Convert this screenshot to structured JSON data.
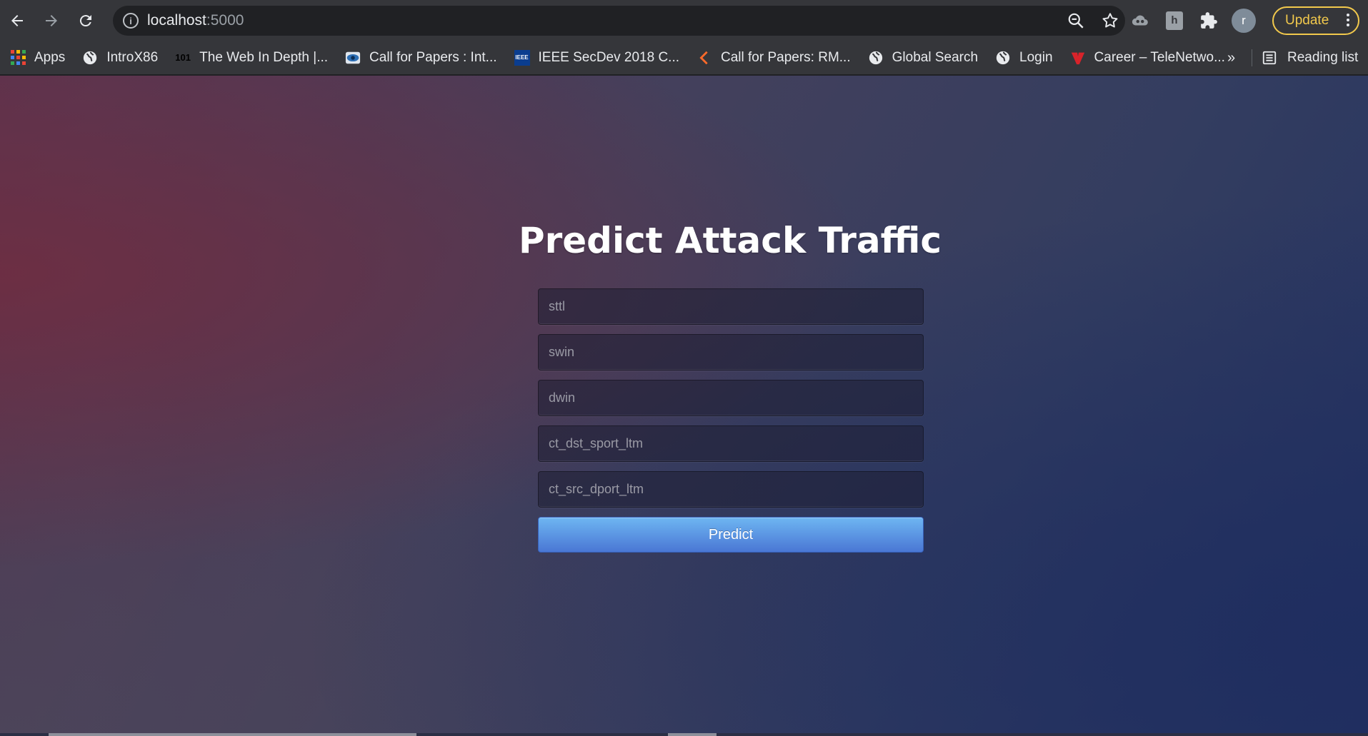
{
  "browser": {
    "url_host": "localhost",
    "url_port": ":5000",
    "update_label": "Update",
    "avatar_letter": "r",
    "bookmarks": [
      {
        "label": "Apps",
        "icon": "apps-grid-icon"
      },
      {
        "label": "IntroX86",
        "icon": "globe-icon"
      },
      {
        "label": "The Web In Depth |...",
        "icon": "101-icon"
      },
      {
        "label": "Call for Papers : Int...",
        "icon": "eye-icon"
      },
      {
        "label": "IEEE SecDev 2018 C...",
        "icon": "ieee-icon"
      },
      {
        "label": "Call for Papers: RM...",
        "icon": "chevron-orange-icon"
      },
      {
        "label": "Global Search",
        "icon": "globe-icon"
      },
      {
        "label": "Login",
        "icon": "globe-icon"
      },
      {
        "label": "Career – TeleNetwo...",
        "icon": "red-logo-icon"
      }
    ],
    "more_label": "»",
    "reading_list_label": "Reading list"
  },
  "page": {
    "title": "Predict Attack Traffic",
    "fields": [
      {
        "placeholder": "sttl",
        "value": ""
      },
      {
        "placeholder": "swin",
        "value": ""
      },
      {
        "placeholder": "dwin",
        "value": ""
      },
      {
        "placeholder": "ct_dst_sport_ltm",
        "value": ""
      },
      {
        "placeholder": "ct_src_dport_ltm",
        "value": ""
      }
    ],
    "submit_label": "Predict"
  },
  "colors": {
    "accent_button": "#4a77d4",
    "update_border": "#f2c94c"
  }
}
